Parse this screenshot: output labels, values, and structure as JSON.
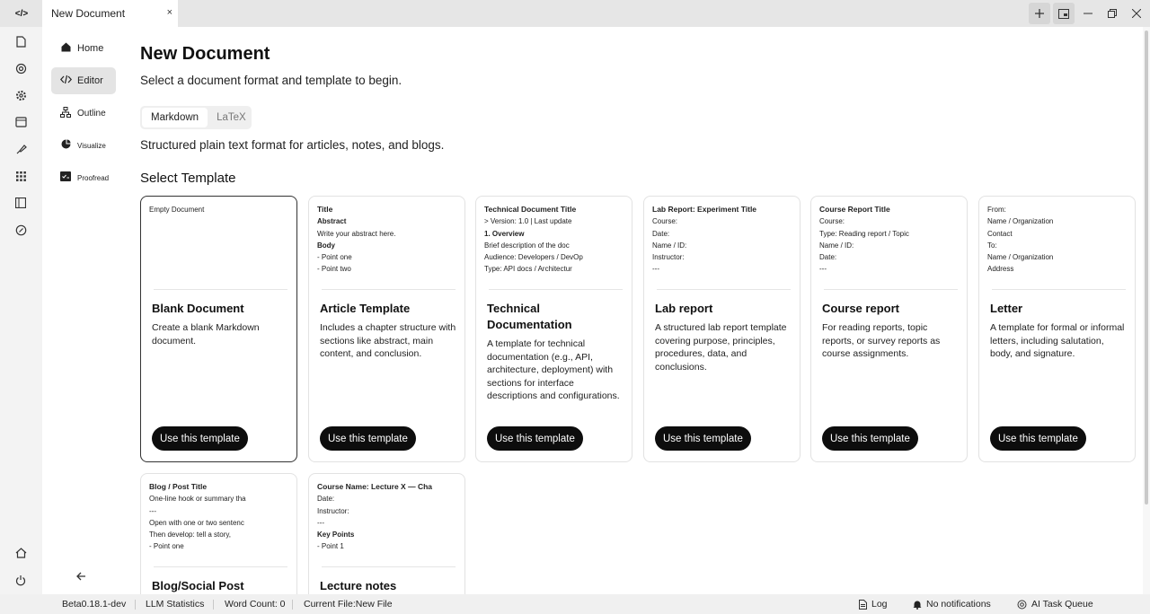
{
  "titlebar": {
    "logo": "</>",
    "tab_title": "New Document",
    "tab_close": "×"
  },
  "sidebar": {
    "items": [
      {
        "label": "Home",
        "icon": "home-icon"
      },
      {
        "label": "Editor",
        "icon": "code-icon"
      },
      {
        "label": "Outline",
        "icon": "outline-icon"
      },
      {
        "label": "Visualize",
        "icon": "pie-chart-icon"
      },
      {
        "label": "Proofread",
        "icon": "proofread-icon"
      }
    ]
  },
  "main": {
    "title": "New Document",
    "subtitle": "Select a document format and template to begin.",
    "formats": [
      "Markdown",
      "LaTeX"
    ],
    "active_format": "Markdown",
    "format_description": "Structured plain text format for articles, notes, and blogs.",
    "section_title": "Select Template",
    "use_label": "Use this template",
    "templates": [
      {
        "preview": [
          "Empty Document"
        ],
        "title": "Blank Document",
        "description": "Create a blank Markdown document."
      },
      {
        "preview": [
          "Title",
          "Abstract",
          "Write your abstract here.",
          "Body",
          "- Point one",
          "- Point two"
        ],
        "title": "Article Template",
        "description": "Includes a chapter structure with sections like abstract, main content, and conclusion."
      },
      {
        "preview": [
          "Technical Document Title",
          "> Version: 1.0 | Last update",
          "1. Overview",
          "Brief description of the doc",
          "Audience: Developers / DevOp",
          "Type: API docs / Architectur"
        ],
        "title": "Technical Documentation",
        "description": "A template for technical documentation (e.g., API, architecture, deployment) with sections for interface descriptions and configurations."
      },
      {
        "preview": [
          "Lab Report: Experiment Title",
          "Course:",
          "Date:",
          "Name / ID:",
          "Instructor:",
          "---"
        ],
        "title": "Lab report",
        "description": "A structured lab report template covering purpose, principles, procedures, data, and conclusions."
      },
      {
        "preview": [
          "Course Report Title",
          "Course:",
          "Type: Reading report / Topic",
          "Name / ID:",
          "Date:",
          "---"
        ],
        "title": "Course report",
        "description": "For reading reports, topic reports, or survey reports as course assignments."
      },
      {
        "preview": [
          "From:",
          "Name / Organization",
          "Contact",
          "To:",
          "Name / Organization",
          "Address"
        ],
        "title": "Letter",
        "description": "A template for formal or informal letters, including salutation, body, and signature."
      },
      {
        "preview": [
          "Blog / Post Title",
          "One-line hook or summary tha",
          "---",
          "Open with one or two sentenc",
          "Then develop: tell a story,",
          "- Point one"
        ],
        "title": "Blog/Social Post",
        "description": ""
      },
      {
        "preview": [
          "Course Name: Lecture X — Cha",
          "Date:",
          "Instructor:",
          "---",
          "Key Points",
          "- Point 1"
        ],
        "title": "Lecture notes",
        "description": ""
      }
    ]
  },
  "statusbar": {
    "version": "Beta0.18.1-dev",
    "llm_stats": "LLM Statistics",
    "word_count": "Word Count: 0",
    "current_file": "Current File:New File",
    "log": "Log",
    "notifications": "No notifications",
    "task_queue": "AI Task Queue"
  }
}
